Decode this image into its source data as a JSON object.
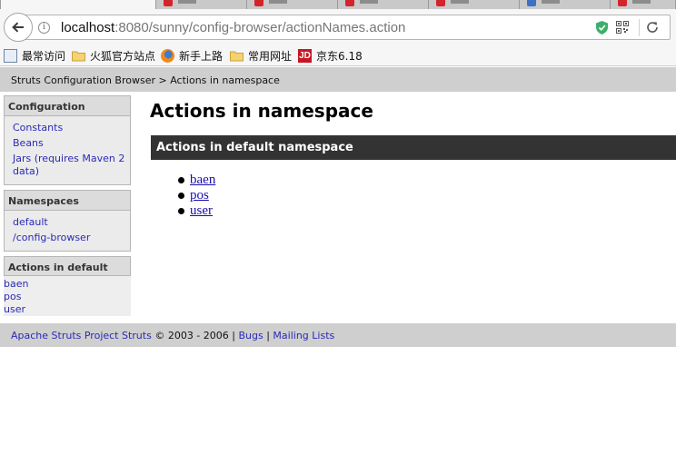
{
  "browser": {
    "url_host": "localhost",
    "url_rest": ":8080/sunny/config-browser/actionNames.action",
    "bookmarks": [
      {
        "label": "最常访问",
        "icon": "page-icon"
      },
      {
        "label": "火狐官方站点",
        "icon": "folder-icon"
      },
      {
        "label": "新手上路",
        "icon": "firefox-icon"
      },
      {
        "label": "常用网址",
        "icon": "folder-icon"
      },
      {
        "label": "京东6.18",
        "icon": "jd-icon",
        "icon_text": "JD"
      }
    ],
    "colors": {
      "jd": "#c81623",
      "shield": "#3cb06b"
    }
  },
  "breadcrumb": "Struts Configuration Browser > Actions in namespace",
  "sidebar": {
    "configuration": {
      "title": "Configuration",
      "items": [
        "Constants",
        "Beans",
        "Jars (requires Maven 2 data)"
      ]
    },
    "namespaces": {
      "title": "Namespaces",
      "items": [
        "default",
        "/config-browser"
      ]
    },
    "actions": {
      "title": "Actions in default",
      "items": [
        "baen",
        "pos",
        "user"
      ]
    }
  },
  "main": {
    "title": "Actions in namespace",
    "section_title": "Actions in default namespace",
    "actions": [
      "baen",
      "pos",
      "user"
    ]
  },
  "footer": {
    "project_link": "Apache Struts Project Struts",
    "copyright": " © 2003 - 2006 | ",
    "bugs_link": "Bugs",
    "separator": " | ",
    "mailing_link": "Mailing Lists"
  }
}
